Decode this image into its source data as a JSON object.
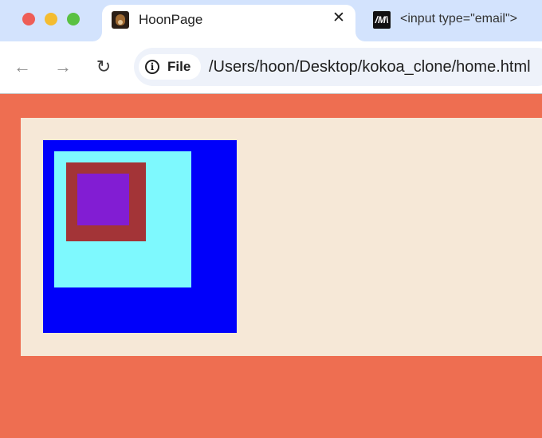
{
  "browser": {
    "window_controls": [
      "close",
      "minimize",
      "maximize"
    ],
    "tabs": [
      {
        "title": "HoonPage",
        "active": true,
        "favicon": "dog-photo-favicon",
        "close_glyph": "✕"
      },
      {
        "title": "<input type=\"email\">",
        "active": false,
        "favicon": "mdn-favicon",
        "favicon_text": "/M\\"
      }
    ],
    "toolbar": {
      "back_glyph": "←",
      "forward_glyph": "→",
      "reload_glyph": "↻",
      "info_glyph": "i",
      "site_chip_label": "File",
      "url": "/Users/hoon/Desktop/kokoa_clone/home.html"
    }
  },
  "page": {
    "background_color": "#ee6e51",
    "container_color": "#f6e8d7",
    "boxes": [
      {
        "name": "blue",
        "color": "#0000fa"
      },
      {
        "name": "cyan",
        "color": "#7ef9fe"
      },
      {
        "name": "brown",
        "color": "#a33437"
      },
      {
        "name": "purple",
        "color": "#821dd3"
      }
    ]
  }
}
